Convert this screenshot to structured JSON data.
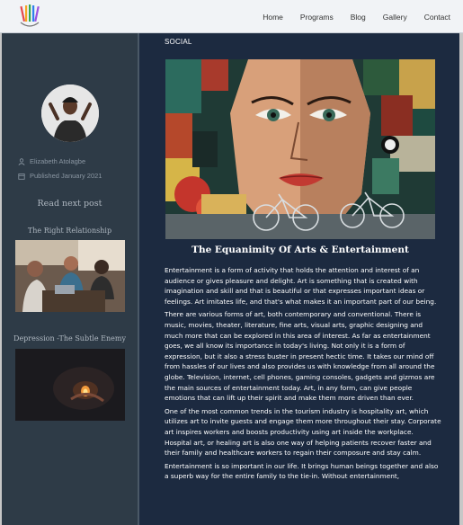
{
  "nav": {
    "items": [
      {
        "label": "Home"
      },
      {
        "label": "Programs"
      },
      {
        "label": "Blog"
      },
      {
        "label": "Gallery"
      },
      {
        "label": "Contact"
      }
    ]
  },
  "author": {
    "name": "Elizabeth Atolagbe",
    "published": "Published January 2021"
  },
  "sidebar": {
    "read_next": "Read next post",
    "posts": [
      {
        "title": "The Right Relationship"
      },
      {
        "title": "Depression -The Subtle Enemy"
      }
    ]
  },
  "article": {
    "category": "SOCIAL",
    "title": "The Equanimity Of Arts & Entertainment",
    "paragraphs": [
      "Entertainment is a form of activity that holds the attention and interest of an audience or gives pleasure and delight. Art is something that is created with imagination and skill and that is beautiful or that expresses important ideas or feelings. Art imitates life, and that's what makes it an important part of our being.",
      "There are various forms of art, both contemporary and conventional. There is music, movies, theater, literature, fine arts, visual arts, graphic designing and much more that can be explored in this area of interest. As far as entertainment goes, we all know its importance in today's living. Not only it is a form of expression, but it also a stress buster in present hectic time. It takes our mind off from hassles of our lives and also provides us with knowledge from all around the globe. Television, internet, cell phones, gaming consoles, gadgets and gizmos are the main sources of entertainment today. Art, in any form, can give people emotions that can lift up their spirit and make them more driven than ever.",
      "One of the most common trends in the tourism industry is hospitality art, which utilizes art to invite guests and engage them more throughout their stay. Corporate art inspires workers and boosts productivity using art inside the workplace. Hospital art, or healing art is also one way of helping patients recover faster and their family and healthcare workers to regain their composure and stay calm.",
      "Entertainment is so important in our life. It brings human beings together and also a superb way for the entire family to the tie-in. Without entertainment,"
    ]
  },
  "icons": {
    "logo": "brush-logo-icon",
    "author": "user-icon",
    "date": "calendar-icon"
  },
  "colors": {
    "topbar": "#f1f3f6",
    "sidebar": "#2e3b47",
    "main": "#1c2a40",
    "text": "#ffffff",
    "muted": "#8a96a2"
  }
}
